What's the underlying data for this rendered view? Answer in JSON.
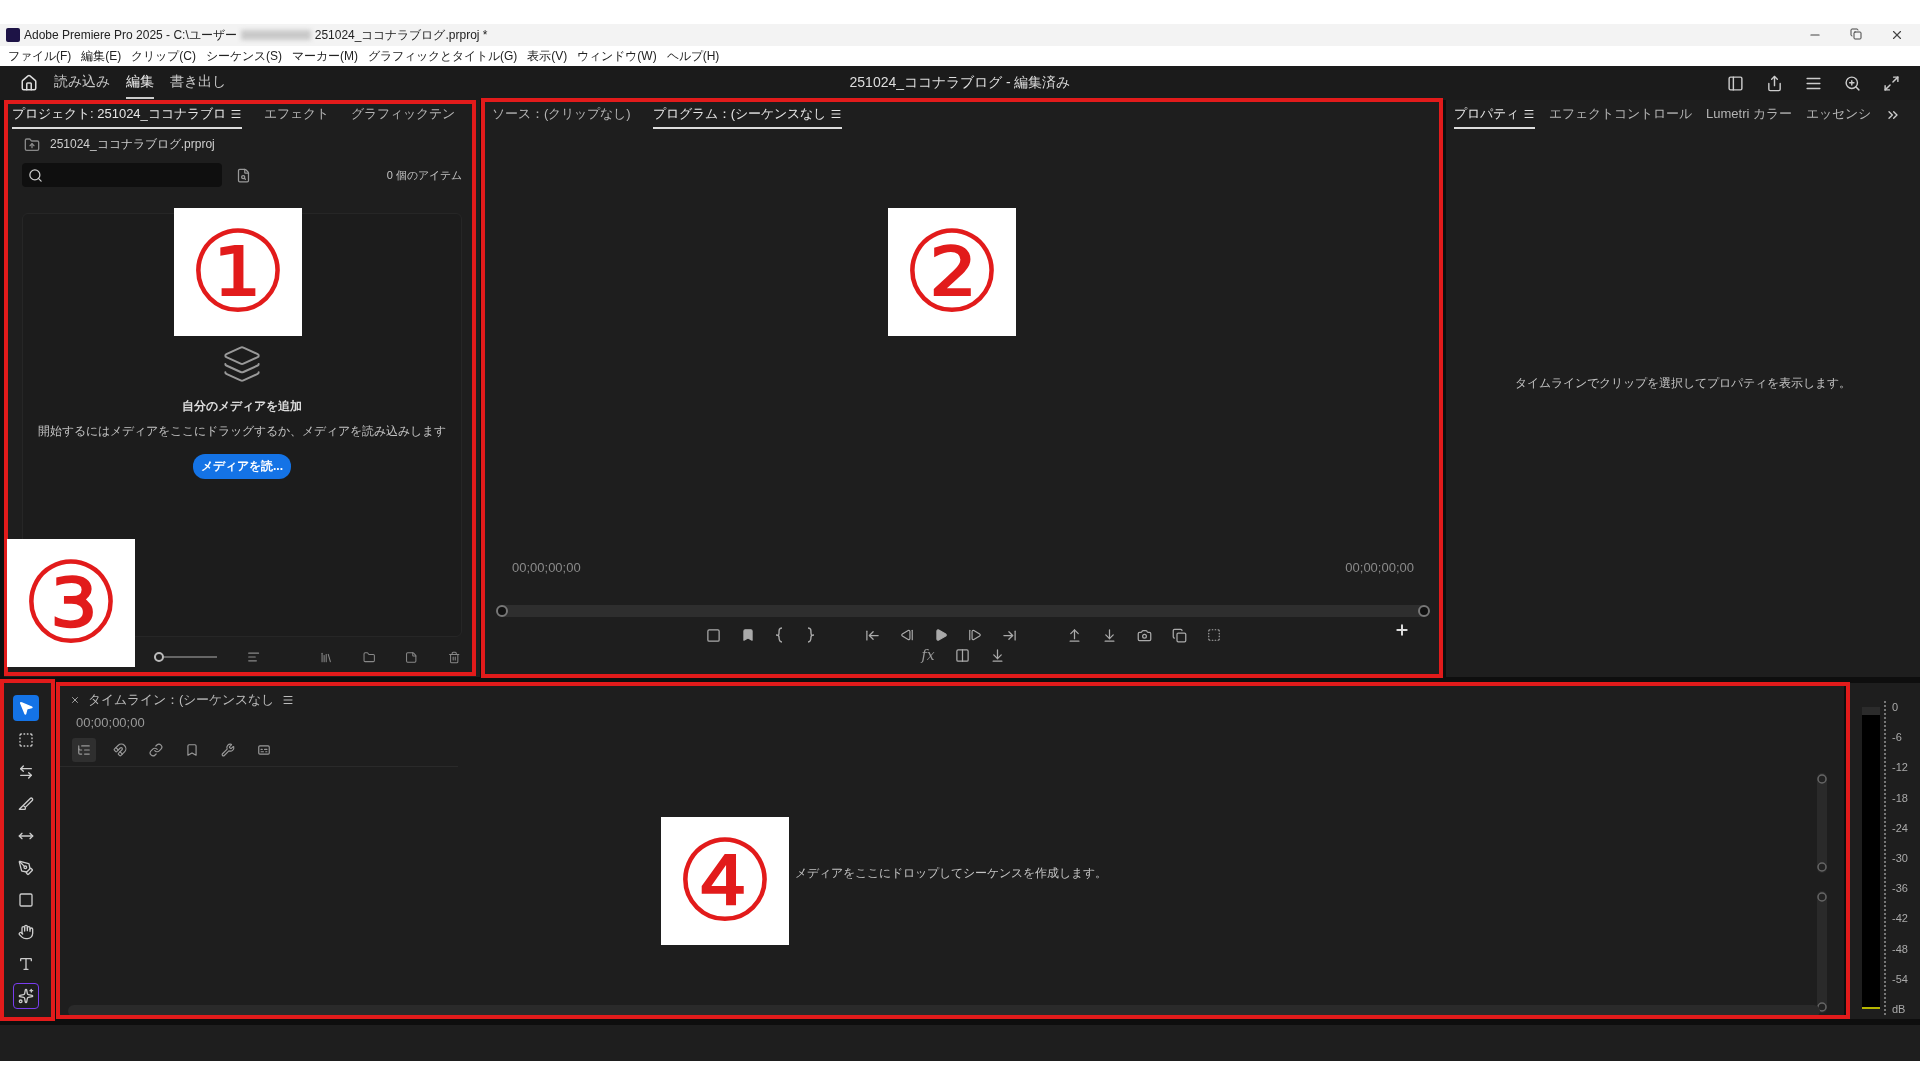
{
  "window": {
    "title_start": "Adobe Premiere Pro 2025 - C:\\ユーザー",
    "title_end": "251024_ココナラブログ.prproj *"
  },
  "menu": [
    "ファイル(F)",
    "編集(E)",
    "クリップ(C)",
    "シーケンス(S)",
    "マーカー(M)",
    "グラフィックとタイトル(G)",
    "表示(V)",
    "ウィンドウ(W)",
    "ヘルプ(H)"
  ],
  "workspace": {
    "tabs": [
      {
        "label": "読み込み",
        "selected": false
      },
      {
        "label": "編集",
        "selected": true
      },
      {
        "label": "書き出し",
        "selected": false
      }
    ],
    "title": "251024_ココナラブログ - 編集済み"
  },
  "project_panel": {
    "tabs": [
      {
        "label": "プロジェクト: 251024_ココナラブロ",
        "selected": true
      },
      {
        "label": "エフェクト",
        "selected": false
      },
      {
        "label": "グラフィックテン",
        "selected": false
      }
    ],
    "file": "251024_ココナラブログ.prproj",
    "item_count": "0 個のアイテム",
    "empty_heading": "自分のメディアを追加",
    "empty_body": "開始するにはメディアをここにドラッグするか、メディアを読み込みします",
    "import_button": "メディアを読...",
    "zoom_slider": {
      "level": 0
    }
  },
  "program_monitor": {
    "tabs": [
      {
        "label": "ソース：(クリップなし)",
        "selected": false
      },
      {
        "label": "プログラム：(シーケンスなし",
        "selected": true
      }
    ],
    "timecode_in": "00;00;00;00",
    "timecode_out": "00;00;00;00",
    "fx": "fx"
  },
  "properties_panel": {
    "tabs": [
      {
        "label": "プロパティ",
        "selected": true
      },
      {
        "label": "エフェクトコントロール",
        "selected": false
      },
      {
        "label": "Lumetri カラー",
        "selected": false
      },
      {
        "label": "エッセンシ",
        "selected": false
      }
    ],
    "message": "タイムラインでクリップを選択してプロパティを表示します。"
  },
  "tools": [
    {
      "kind": "selection",
      "selected": true
    },
    {
      "kind": "track",
      "selected": false
    },
    {
      "kind": "ripple",
      "selected": false
    },
    {
      "kind": "razor",
      "selected": false
    },
    {
      "kind": "slip",
      "selected": false
    },
    {
      "kind": "pen",
      "selected": false
    },
    {
      "kind": "rectangle",
      "selected": false
    },
    {
      "kind": "hand",
      "selected": false
    },
    {
      "kind": "type",
      "selected": false
    },
    {
      "kind": "generative",
      "selected": false
    }
  ],
  "timeline": {
    "title": "タイムライン：(シーケンスなし",
    "timecode": "00;00;00;00",
    "toggles": [
      {
        "kind": "nest",
        "on": true
      },
      {
        "kind": "snap",
        "on": false
      },
      {
        "kind": "linked",
        "on": false
      },
      {
        "kind": "marker",
        "on": false
      },
      {
        "kind": "settings",
        "on": false
      },
      {
        "kind": "captions",
        "on": false
      }
    ],
    "message": "メディアをここにドロップしてシーケンスを作成します。"
  },
  "audio_meter": {
    "scale": [
      "0",
      "-6",
      "-12",
      "-18",
      "-24",
      "-30",
      "-36",
      "-42",
      "-48",
      "-54",
      "dB"
    ]
  },
  "annotations": [
    {
      "label": "①"
    },
    {
      "label": "②"
    },
    {
      "label": "③"
    },
    {
      "label": "④"
    }
  ]
}
